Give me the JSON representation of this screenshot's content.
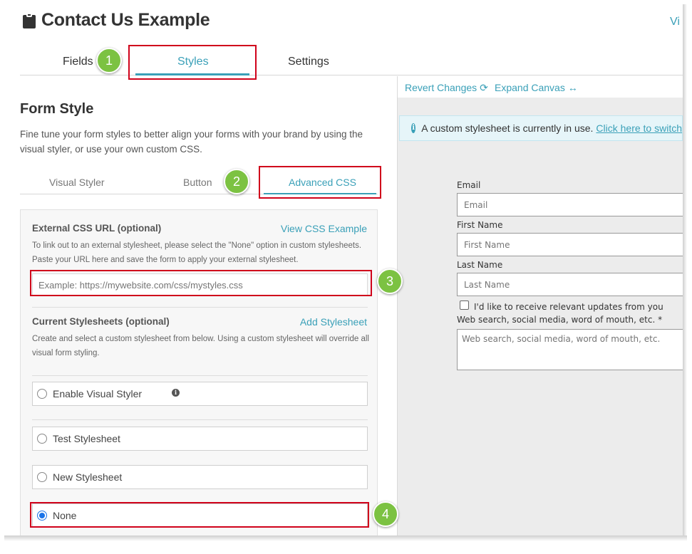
{
  "header": {
    "title": "Contact Us Example",
    "top_right_link": "Vi",
    "icon": "clipboard-icon"
  },
  "main_tabs": [
    {
      "label": "Fields"
    },
    {
      "label": "Styles",
      "active": true
    },
    {
      "label": "Settings"
    }
  ],
  "form_style": {
    "title": "Form Style",
    "description": "Fine tune your form styles to better align your forms with your brand by using the visual styler, or use your own custom CSS."
  },
  "sub_tabs": [
    {
      "label": "Visual Styler"
    },
    {
      "label": "Button"
    },
    {
      "label": "Advanced CSS",
      "active": true
    }
  ],
  "external_css": {
    "label": "External CSS URL (optional)",
    "link": "View CSS Example",
    "help": "To link out to an external stylesheet, please select the \"None\" option in custom stylesheets. Paste your URL here and save the form to apply your external stylesheet.",
    "placeholder": "Example: https://mywebsite.com/css/mystyles.css",
    "value": ""
  },
  "stylesheets": {
    "label": "Current Stylesheets (optional)",
    "link": "Add Stylesheet",
    "help": "Create and select a custom stylesheet from below. Using a custom stylesheet will override all visual form styling.",
    "options": [
      {
        "label": "Enable Visual Styler",
        "checked": false,
        "info_icon": "i"
      },
      {
        "label": "Test Stylesheet",
        "checked": false
      },
      {
        "label": "New Stylesheet",
        "checked": false
      },
      {
        "label": "None",
        "checked": true
      }
    ]
  },
  "steps": [
    "1",
    "2",
    "3",
    "4"
  ],
  "preview": {
    "revert_label": "Revert Changes",
    "revert_icon": "refresh-icon",
    "revert_glyph": "⟳",
    "expand_label": "Expand Canvas",
    "expand_icon": "horizontal-arrows-icon",
    "expand_glyph": "↔",
    "alert_icon": "i",
    "alert_text": "A custom stylesheet is currently in use.",
    "alert_link": "Click here to switch",
    "form": {
      "email_label": "Email",
      "email_placeholder": "Email",
      "first_name_label": "First Name",
      "first_name_placeholder": "First Name",
      "last_name_label": "Last Name",
      "last_name_placeholder": "Last Name",
      "checkbox_label": "I'd like to receive relevant updates from you",
      "source_label": "Web search, social media, word of mouth, etc. *",
      "source_placeholder": "Web search, social media, word of mouth, etc."
    }
  },
  "colors": {
    "accent": "#3aa0b8",
    "highlight": "#d0021b",
    "step_badge": "#7cc242"
  }
}
